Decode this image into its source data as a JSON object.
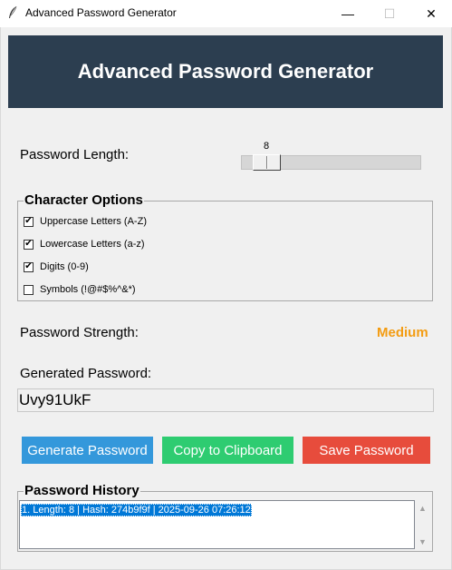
{
  "window": {
    "title": "Advanced Password Generator",
    "min_glyph": "—",
    "max_glyph": "☐",
    "close_glyph": "✕"
  },
  "header": {
    "title": "Advanced Password Generator",
    "bg_color": "#2c3e50"
  },
  "length": {
    "label": "Password Length:",
    "value": "8"
  },
  "options": {
    "title": "Character Options",
    "items": [
      {
        "label": "Uppercase Letters (A-Z)",
        "checked": true
      },
      {
        "label": "Lowercase Letters (a-z)",
        "checked": true
      },
      {
        "label": "Digits (0-9)",
        "checked": true
      },
      {
        "label": "Symbols (!@#$%^&*)",
        "checked": false
      }
    ]
  },
  "strength": {
    "label": "Password Strength:",
    "value": "Medium",
    "color": "#f39c12"
  },
  "generated": {
    "label": "Generated Password:",
    "value": "Uvy91UkF"
  },
  "buttons": {
    "generate": {
      "label": "Generate Password",
      "color": "#3498db"
    },
    "copy": {
      "label": "Copy to Clipboard",
      "color": "#2ecc71"
    },
    "save": {
      "label": "Save Password",
      "color": "#e74c3c"
    }
  },
  "history": {
    "title": "Password History",
    "items": [
      "1. Length: 8 | Hash: 274b9f9f | 2025-09-26 07:26:12"
    ]
  },
  "icons": {
    "app": "feather-icon",
    "check": "✔",
    "scroll_up": "▲",
    "scroll_down": "▼"
  }
}
